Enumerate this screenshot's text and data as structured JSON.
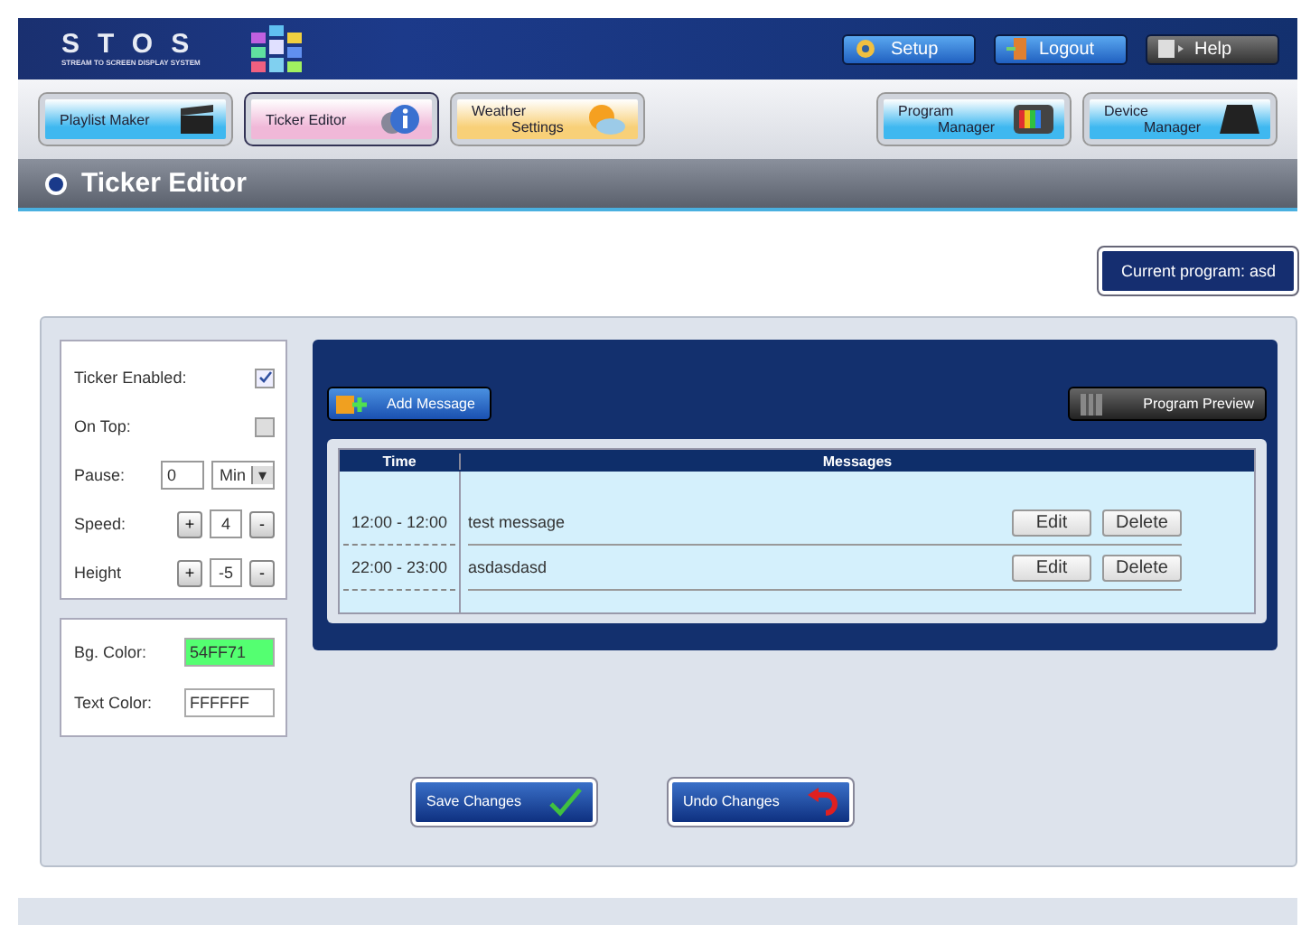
{
  "logo": {
    "name": "STOS",
    "tagline": "STREAM TO SCREEN DISPLAY SYSTEM"
  },
  "header_buttons": [
    {
      "label": "Setup",
      "kind": "setup"
    },
    {
      "label": "Logout",
      "kind": "logout"
    },
    {
      "label": "Help",
      "kind": "help"
    }
  ],
  "nav": [
    {
      "lines": [
        "Playlist Maker"
      ],
      "color": "#3fb8f0",
      "selected": false,
      "kind": "clapper"
    },
    {
      "lines": [
        "Ticker Editor"
      ],
      "color": "#f0b8d8",
      "selected": true,
      "kind": "info"
    },
    {
      "lines": [
        "Weather",
        "Settings"
      ],
      "color": "#f8d078",
      "selected": false,
      "kind": "weather"
    },
    {
      "lines": [
        "Program",
        "Manager"
      ],
      "color": "#3fb8f0",
      "selected": false,
      "kind": "tv"
    },
    {
      "lines": [
        "Device",
        "Manager"
      ],
      "color": "#3fb8f0",
      "selected": false,
      "kind": "device"
    }
  ],
  "page_title": "Ticker Editor",
  "current_program": "Current program: asd",
  "settings": [
    {
      "kind": "checkbox",
      "label": "Ticker Enabled:",
      "checked": true
    },
    {
      "kind": "checkbox",
      "label": "On Top:",
      "checked": false
    },
    {
      "kind": "pause",
      "label": "Pause:",
      "value": "0",
      "unit": "Min",
      "arrow": "▾"
    },
    {
      "kind": "stepper",
      "label": "Speed:",
      "plus": "+",
      "value": "4",
      "minus": "-"
    },
    {
      "kind": "stepper",
      "label": "Height",
      "plus": "+",
      "value": "-5",
      "minus": "-"
    }
  ],
  "colors": [
    {
      "label": "Bg. Color:",
      "value": "54FF71",
      "color": "#54ff71"
    },
    {
      "label": "Text Color:",
      "value": "FFFFFF",
      "color": "#ffffff"
    }
  ],
  "add_message": "Add Message",
  "program_preview": "Program Preview",
  "table": {
    "columns": [
      "Time",
      "Messages"
    ],
    "rows": [
      {
        "time": "12:00 - 12:00",
        "message": "test message",
        "edit": "Edit",
        "delete": "Delete"
      },
      {
        "time": "22:00 - 23:00",
        "message": "asdasdasd",
        "edit": "Edit",
        "delete": "Delete"
      }
    ]
  },
  "save": "Save Changes",
  "undo": "Undo Changes"
}
